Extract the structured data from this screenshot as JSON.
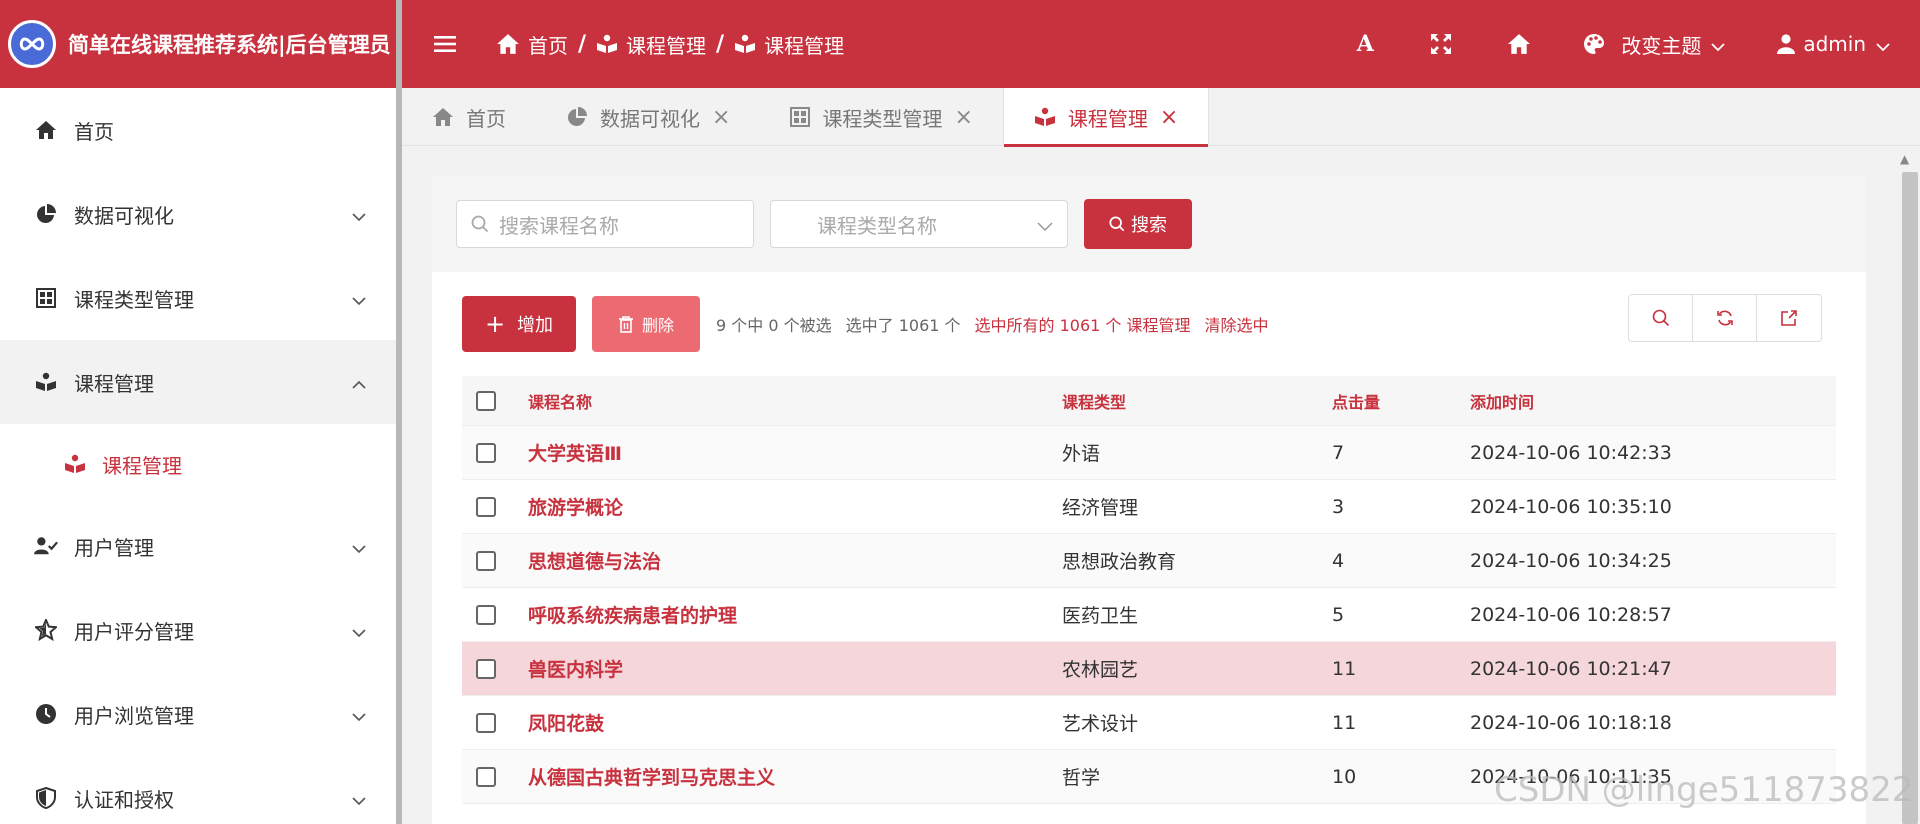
{
  "brand": {
    "title": "简单在线课程推荐系统|后台管理员",
    "logo_icon": "infinity-logo"
  },
  "sidebar": {
    "items": [
      {
        "label": "首页",
        "icon": "home-icon"
      },
      {
        "label": "数据可视化",
        "icon": "pie-chart-icon"
      },
      {
        "label": "课程类型管理",
        "icon": "grid-icon"
      },
      {
        "label": "课程管理",
        "icon": "book-icon",
        "expanded": true
      },
      {
        "label": "用户管理",
        "icon": "user-check-icon"
      },
      {
        "label": "用户评分管理",
        "icon": "star-icon"
      },
      {
        "label": "用户浏览管理",
        "icon": "clock-icon"
      },
      {
        "label": "认证和授权",
        "icon": "shield-icon"
      }
    ],
    "submenu": [
      {
        "label": "课程管理",
        "icon": "book-icon"
      }
    ]
  },
  "header": {
    "breadcrumb": [
      "首页",
      "课程管理",
      "课程管理"
    ],
    "font_button": "A",
    "theme_label": "改变主题",
    "user_label": "admin"
  },
  "tabs": [
    {
      "label": "首页",
      "icon": "home-icon",
      "closable": false
    },
    {
      "label": "数据可视化",
      "icon": "pie-chart-icon",
      "closable": true
    },
    {
      "label": "课程类型管理",
      "icon": "grid-icon",
      "closable": true
    },
    {
      "label": "课程管理",
      "icon": "book-icon",
      "closable": true,
      "active": true
    }
  ],
  "tab_close": "×",
  "search": {
    "name_placeholder": "搜索课程名称",
    "type_placeholder": "课程类型名称",
    "button_label": "搜索"
  },
  "actions": {
    "add_label": "增加",
    "delete_label": "删除",
    "selection_count": "9 个中 0 个被选",
    "selected_total": "选中了 1061 个",
    "select_all": "选中所有的 1061 个 课程管理",
    "clear_selection": "清除选中"
  },
  "table": {
    "headers": {
      "name": "课程名称",
      "type": "课程类型",
      "clicks": "点击量",
      "time": "添加时间"
    },
    "rows": [
      {
        "name": "大学英语Ⅲ",
        "type": "外语",
        "clicks": "7",
        "time": "2024-10-06 10:42:33"
      },
      {
        "name": "旅游学概论",
        "type": "经济管理",
        "clicks": "3",
        "time": "2024-10-06 10:35:10"
      },
      {
        "name": "思想道德与法治",
        "type": "思想政治教育",
        "clicks": "4",
        "time": "2024-10-06 10:34:25"
      },
      {
        "name": "呼吸系统疾病患者的护理",
        "type": "医药卫生",
        "clicks": "5",
        "time": "2024-10-06 10:28:57"
      },
      {
        "name": "兽医内科学",
        "type": "农林园艺",
        "clicks": "11",
        "time": "2024-10-06 10:21:47"
      },
      {
        "name": "凤阳花鼓",
        "type": "艺术设计",
        "clicks": "11",
        "time": "2024-10-06 10:18:18"
      },
      {
        "name": "从德国古典哲学到马克思主义",
        "type": "哲学",
        "clicks": "10",
        "time": "2024-10-06 10:11:35"
      }
    ]
  },
  "watermark": "CSDN @linge511873822",
  "colors": {
    "primary": "#c8313e",
    "danger_light": "#ec6b73",
    "row_highlight": "#f5d6da"
  }
}
